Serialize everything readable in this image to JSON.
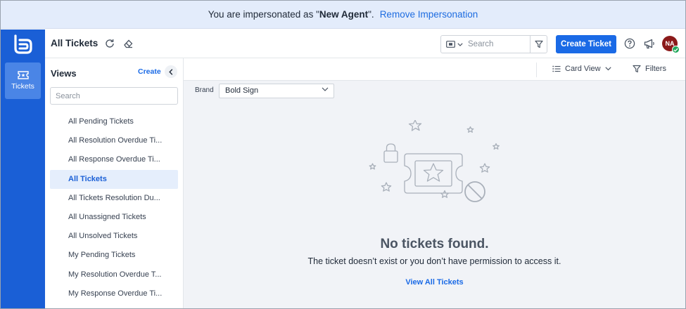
{
  "banner": {
    "prefix": "You are impersonated as \"",
    "agent_name": "New Agent",
    "suffix": "\".",
    "remove_label": "Remove Impersonation"
  },
  "rail": {
    "tickets_label": "Tickets"
  },
  "header": {
    "title": "All Tickets",
    "search_placeholder": "Search",
    "create_label": "Create Ticket",
    "avatar_initials": "NA"
  },
  "views": {
    "title": "Views",
    "create_label": "Create",
    "search_placeholder": "Search",
    "items": [
      {
        "label": "All Pending Tickets"
      },
      {
        "label": "All Resolution Overdue Ti..."
      },
      {
        "label": "All Response Overdue Ti..."
      },
      {
        "label": "All Tickets"
      },
      {
        "label": "All Tickets Resolution Du..."
      },
      {
        "label": "All Unassigned Tickets"
      },
      {
        "label": "All Unsolved Tickets"
      },
      {
        "label": "My Pending Tickets"
      },
      {
        "label": "My Resolution Overdue T..."
      },
      {
        "label": "My Response Overdue Ti..."
      }
    ],
    "active_index": 3
  },
  "toolbar": {
    "card_view_label": "Card View",
    "filters_label": "Filters"
  },
  "brand": {
    "label": "Brand",
    "selected": "Bold Sign"
  },
  "empty_state": {
    "title": "No tickets found.",
    "message": "The ticket doesn’t exist or you don’t have permission to access it.",
    "link_label": "View All Tickets"
  },
  "colors": {
    "primary": "#1a6ae6",
    "rail": "#1a5fd6",
    "banner_bg": "#e3ecfb",
    "active_view_bg": "#e5eefc"
  }
}
